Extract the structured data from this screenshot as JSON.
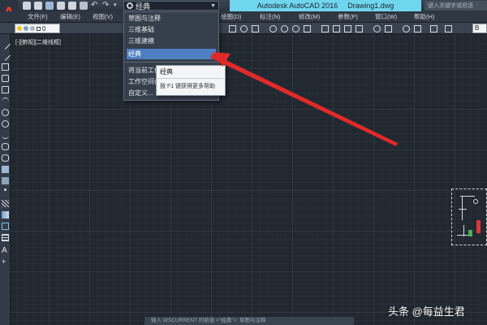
{
  "titlebar": {
    "workspace_value": "经典",
    "app_name": "Autodesk AutoCAD 2016",
    "file_name": "Drawing1.dwg",
    "search_placeholder": "键入关键字或短语"
  },
  "menubar": {
    "items": [
      "文件(F)",
      "编辑(E)",
      "视图(V)",
      "绘图(D)",
      "标注(N)",
      "修改(M)",
      "参数(P)",
      "窗口(W)",
      "帮助(H)"
    ]
  },
  "toolbar": {
    "layer_value": "0",
    "right_combo_value": "B"
  },
  "viewport": {
    "label": "[-][俯视][二维线框]"
  },
  "workspace_dropdown": {
    "items": [
      "草图与注释",
      "三维基础",
      "三维建模",
      "经典"
    ],
    "selected": "经典",
    "extra_items": [
      "将当前工作空间另存为...",
      "工作空间设置...",
      "自定义..."
    ]
  },
  "tooltip": {
    "title": "经典",
    "help": "按 F1 键获得更多帮助"
  },
  "command_line": {
    "text": "输入 WSCURRENT 的新值 <\"经典\">: 草图与注释"
  },
  "watermark": {
    "text": "头条 @每益生君"
  },
  "colors": {
    "background": "#212830",
    "title_highlight": "#6fd6ee",
    "selection": "#4f7fc2",
    "arrow": "#e02a2a",
    "logo": "#e23a2a"
  }
}
